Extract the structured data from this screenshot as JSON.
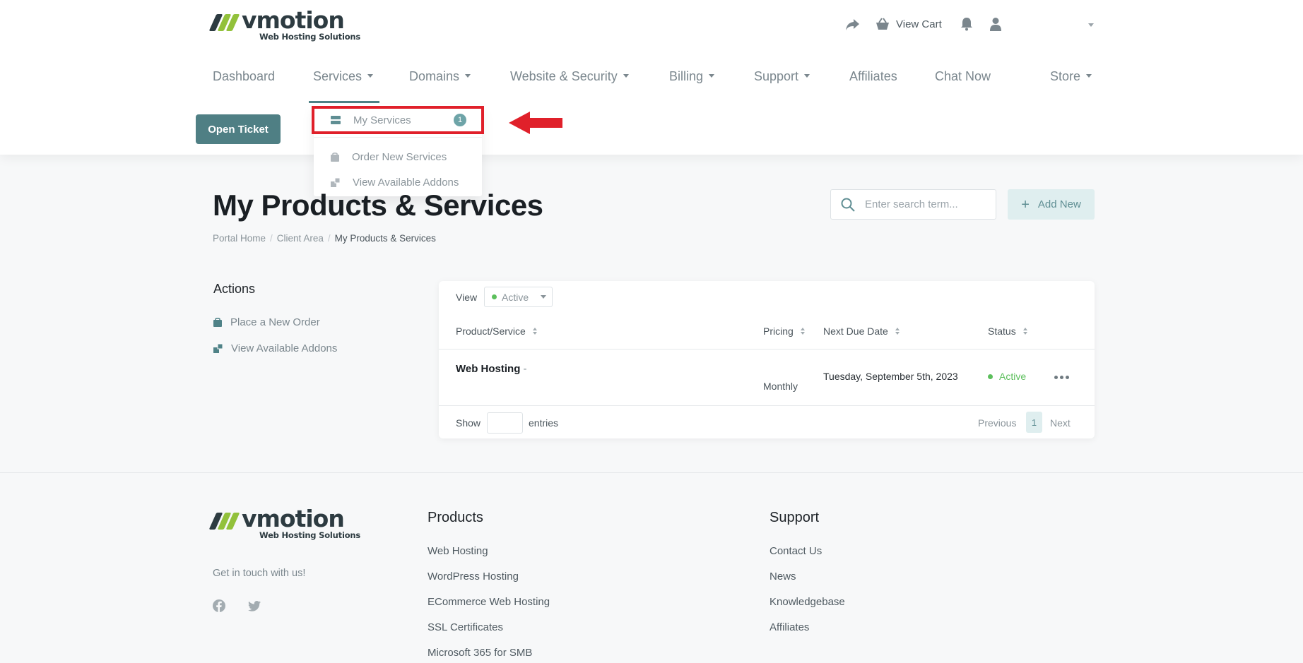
{
  "brand": {
    "name": "vmotion",
    "tagline": "Web Hosting Solutions"
  },
  "topbar": {
    "view_cart": "View Cart"
  },
  "nav": {
    "items": [
      {
        "label": "Dashboard",
        "dropdown": false
      },
      {
        "label": "Services",
        "dropdown": true
      },
      {
        "label": "Domains",
        "dropdown": true
      },
      {
        "label": "Website & Security",
        "dropdown": true
      },
      {
        "label": "Billing",
        "dropdown": true
      },
      {
        "label": "Support",
        "dropdown": true
      },
      {
        "label": "Affiliates",
        "dropdown": false
      },
      {
        "label": "Chat Now",
        "dropdown": false
      },
      {
        "label": "Store",
        "dropdown": true
      }
    ]
  },
  "open_ticket": "Open Ticket",
  "services_menu": {
    "items": [
      {
        "label": "My Services",
        "badge": "1",
        "icon": "server-icon"
      },
      {
        "label": "Order New Services",
        "icon": "shopping-bag-icon"
      },
      {
        "label": "View Available Addons",
        "icon": "cubes-icon"
      }
    ]
  },
  "page": {
    "title": "My Products & Services",
    "breadcrumb": [
      "Portal Home",
      "Client Area",
      "My Products & Services"
    ],
    "search_placeholder": "Enter search term...",
    "add_new": "Add New"
  },
  "sidebar": {
    "title": "Actions",
    "links": [
      {
        "label": "Place a New Order",
        "icon": "shopping-bag-icon"
      },
      {
        "label": "View Available Addons",
        "icon": "cubes-icon"
      }
    ]
  },
  "table": {
    "view_label": "View",
    "view_value": "Active",
    "columns": [
      "Product/Service",
      "Pricing",
      "Next Due Date",
      "Status"
    ],
    "rows": [
      {
        "product": "Web Hosting",
        "suffix": " -",
        "pricing": "Monthly",
        "next_due": "Tuesday, September 5th, 2023",
        "status": "Active"
      }
    ],
    "show_label": "Show",
    "entries_label": "entries",
    "previous": "Previous",
    "current_page": "1",
    "next": "Next"
  },
  "footer": {
    "note": "Get in touch with us!",
    "products_title": "Products",
    "products": [
      "Web Hosting",
      "WordPress Hosting",
      "ECommerce Web Hosting",
      "SSL Certificates",
      "Microsoft 365 for SMB"
    ],
    "support_title": "Support",
    "support": [
      "Contact Us",
      "News",
      "Knowledgebase",
      "Affiliates"
    ]
  },
  "colors": {
    "accent": "#4f7f84",
    "brand_green": "#92c13b",
    "status_active": "#5cbf5c",
    "highlight": "#e0202a"
  }
}
